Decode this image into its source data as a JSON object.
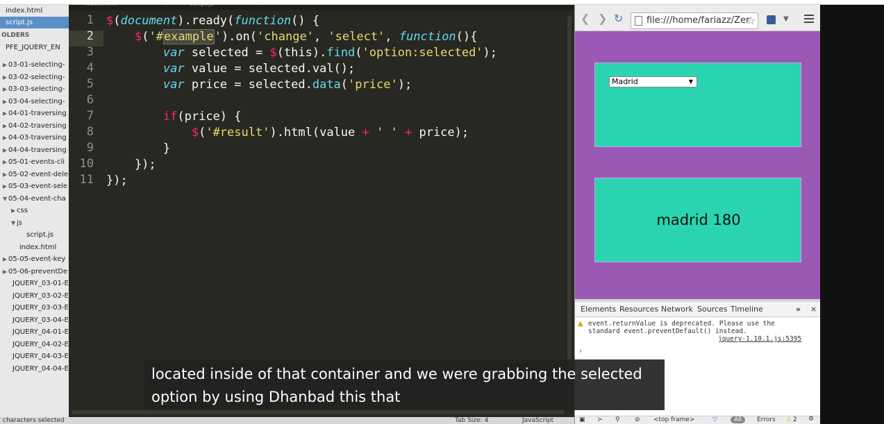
{
  "sidebar": {
    "open_files": [
      {
        "label": "index.html",
        "selected": false
      },
      {
        "label": "script.js",
        "selected": true
      }
    ],
    "folders_header": "OLDERS",
    "root": "PFE_JQUERY_EN",
    "items": [
      {
        "label": "03-01-selecting-",
        "arrow": "▶"
      },
      {
        "label": "03-02-selecting-",
        "arrow": "▶"
      },
      {
        "label": "03-03-selecting-",
        "arrow": "▶"
      },
      {
        "label": "03-04-selecting-",
        "arrow": "▶"
      },
      {
        "label": "04-01-traversing",
        "arrow": "▶"
      },
      {
        "label": "04-02-traversing",
        "arrow": "▶"
      },
      {
        "label": "04-03-traversing",
        "arrow": "▶"
      },
      {
        "label": "04-04-traversing",
        "arrow": "▶"
      },
      {
        "label": "05-01-events-cli",
        "arrow": "▶"
      },
      {
        "label": "05-02-event-dele",
        "arrow": "▶"
      },
      {
        "label": "05-03-event-sele",
        "arrow": "▶"
      },
      {
        "label": "05-04-event-cha",
        "arrow": "▼"
      },
      {
        "label": "css",
        "arrow": "▶"
      },
      {
        "label": "js",
        "arrow": "▼"
      },
      {
        "label": "script.js",
        "arrow": ""
      },
      {
        "label": "index.html",
        "arrow": ""
      },
      {
        "label": "05-05-event-key",
        "arrow": "▶"
      },
      {
        "label": "05-06-preventDe",
        "arrow": "▶"
      },
      {
        "label": "JQUERY_03-01-EI",
        "arrow": ""
      },
      {
        "label": "JQUERY_03-02-EI",
        "arrow": ""
      },
      {
        "label": "JQUERY_03-03-EI",
        "arrow": ""
      },
      {
        "label": "JQUERY_03-04-EI",
        "arrow": ""
      },
      {
        "label": "JQUERY_04-01-EI",
        "arrow": ""
      },
      {
        "label": "JQUERY_04-02-EI",
        "arrow": ""
      },
      {
        "label": "JQUERY_04-03-EI",
        "arrow": ""
      },
      {
        "label": "JQUERY_04-04-EI",
        "arrow": ""
      }
    ]
  },
  "editor": {
    "tabs": [
      "index.html",
      "script.js"
    ],
    "line_numbers": [
      "1",
      "2",
      "3",
      "4",
      "5",
      "6",
      "7",
      "8",
      "9",
      "10",
      "11"
    ],
    "lines": [
      "$(document).ready(function() {",
      "    $('#example').on('change', 'select', function(){",
      "        var selected = $(this).find('option:selected');",
      "        var value = selected.val();",
      "        var price = selected.data('price');",
      "",
      "        if(price) {",
      "            $('#result').html(value + ' ' + price);",
      "        }",
      "    });",
      "});"
    ],
    "status_left": "characters selected",
    "status_tab": "Tab Size: 4",
    "status_syntax": "JavaScript"
  },
  "browser": {
    "url": "file:///home/fariazz/Zer",
    "select_value": "Madrid",
    "result_text": "madrid 180",
    "colors": {
      "page_bg": "#9b59b6",
      "box_bg": "#2bd4b0"
    }
  },
  "devtools": {
    "tabs": [
      "Elements",
      "Resources",
      "Network",
      "Sources",
      "Timeline"
    ],
    "warning": "event.returnValue is deprecated. Please use the\nstandard event.preventDefault() instead.",
    "source_link": "jquery-1.10.1.js:5395",
    "bottom_frame": "<top frame>",
    "bottom_filter": "All",
    "bottom_errors": "Errors",
    "bottom_count": "2"
  },
  "caption": "located inside of that container and we were grabbing the selected\noption by using Dhanbad this that"
}
